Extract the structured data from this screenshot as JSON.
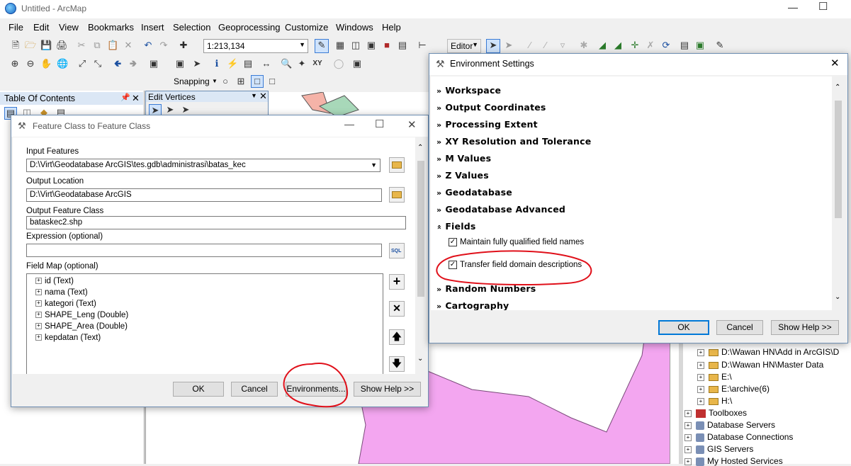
{
  "window": {
    "title": "Untitled - ArcMap"
  },
  "menu": [
    "File",
    "Edit",
    "View",
    "Bookmarks",
    "Insert",
    "Selection",
    "Geoprocessing",
    "Customize",
    "Windows",
    "Help"
  ],
  "toolbar": {
    "scale": "1:213,134",
    "editor_label": "Editor",
    "snapping_label": "Snapping"
  },
  "toc": {
    "title": "Table Of Contents"
  },
  "edit_vertices": {
    "title": "Edit Vertices"
  },
  "fc_dialog": {
    "title": "Feature Class to Feature Class",
    "input_label": "Input Features",
    "input_value": "D:\\Virt\\Geodatabase ArcGIS\\tes.gdb\\administrasi\\batas_kec",
    "out_loc_label": "Output Location",
    "out_loc_value": "D:\\Virt\\Geodatabase ArcGIS",
    "out_fc_label": "Output Feature Class",
    "out_fc_value": "bataskec2.shp",
    "expr_label": "Expression (optional)",
    "expr_value": "",
    "fieldmap_label": "Field Map (optional)",
    "fields": [
      "id (Text)",
      "nama (Text)",
      "kategori (Text)",
      "SHAPE_Leng (Double)",
      "SHAPE_Area (Double)",
      "kepdatan (Text)"
    ],
    "ok": "OK",
    "cancel": "Cancel",
    "environments": "Environments...",
    "show_help": "Show Help >>",
    "sql": "SQL"
  },
  "env_dialog": {
    "title": "Environment Settings",
    "sections": [
      "Workspace",
      "Output Coordinates",
      "Processing Extent",
      "XY Resolution and Tolerance",
      "M Values",
      "Z Values",
      "Geodatabase",
      "Geodatabase Advanced",
      "Fields"
    ],
    "fields_options": [
      "Maintain fully qualified field names",
      "Transfer field domain descriptions"
    ],
    "more_sections": [
      "Random Numbers",
      "Cartography"
    ],
    "ok": "OK",
    "cancel": "Cancel",
    "show_help": "Show Help >>"
  },
  "catalog": {
    "items": [
      {
        "label": "D:\\Wawan HN\\Add in ArcGIS\\D",
        "level": 2
      },
      {
        "label": "D:\\Wawan HN\\Master Data",
        "level": 2
      },
      {
        "label": "E:\\",
        "level": 2
      },
      {
        "label": "E:\\archive(6)",
        "level": 2
      },
      {
        "label": "H:\\",
        "level": 2
      },
      {
        "label": "Toolboxes",
        "level": 1
      },
      {
        "label": "Database Servers",
        "level": 1
      },
      {
        "label": "Database Connections",
        "level": 1
      },
      {
        "label": "GIS Servers",
        "level": 1
      },
      {
        "label": "My Hosted Services",
        "level": 1
      }
    ]
  },
  "colors": {
    "map_polygon": "#f3a6f0",
    "annotation": "#e0101a",
    "dialog_border": "#6f8fb3"
  }
}
